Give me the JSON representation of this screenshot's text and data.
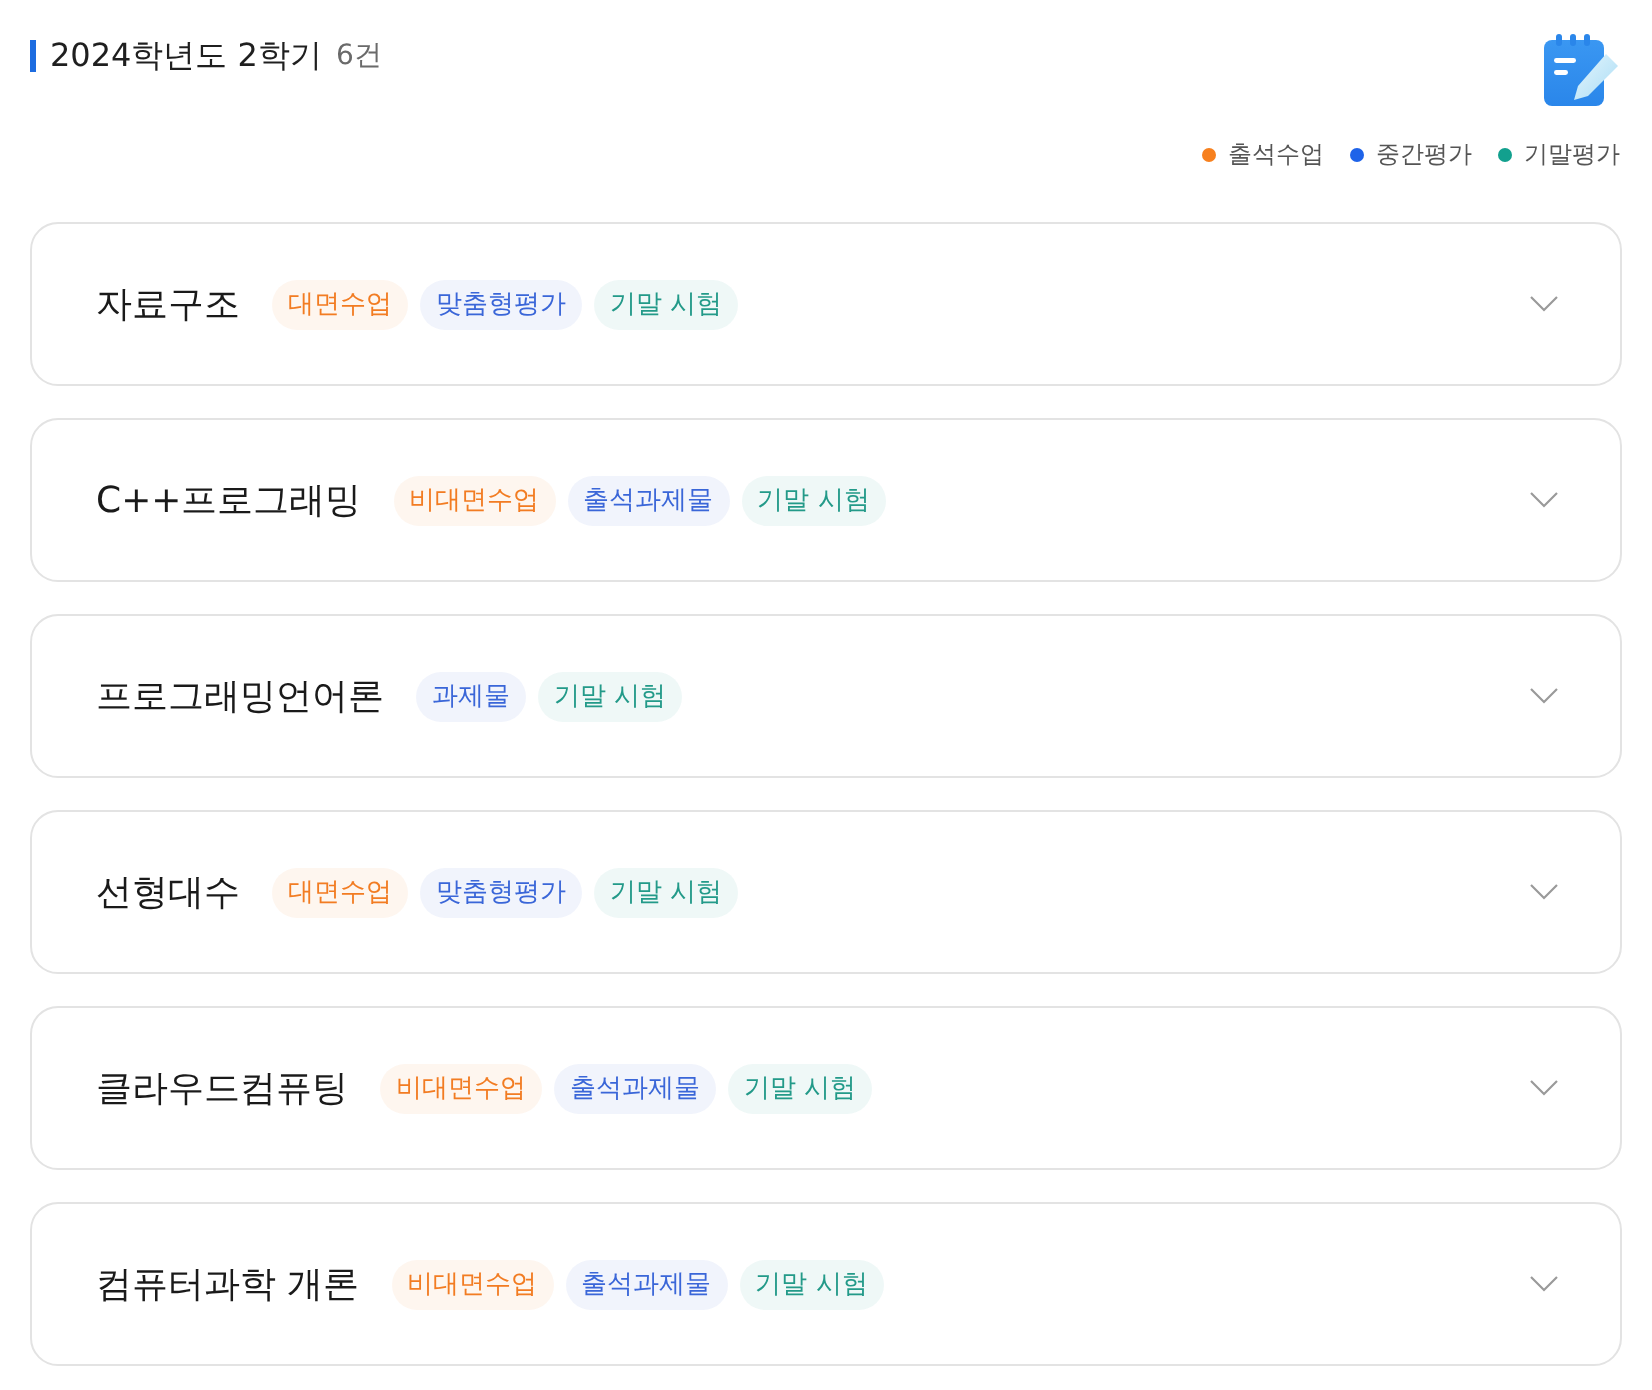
{
  "header": {
    "title": "2024학년도 2학기",
    "count": "6건"
  },
  "legend": [
    {
      "label": "출석수업",
      "color": "#f7801e"
    },
    {
      "label": "중간평가",
      "color": "#1e63e9"
    },
    {
      "label": "기말평가",
      "color": "#12a08e"
    }
  ],
  "courses": [
    {
      "name": "자료구조",
      "expanded": false,
      "tags": [
        {
          "label": "대면수업",
          "color": "#f27c22"
        },
        {
          "label": "맞춤형평가",
          "color": "#3a66d8"
        },
        {
          "label": "기말 시험",
          "color": "#239a89"
        }
      ]
    },
    {
      "name": "C++프로그래밍",
      "expanded": false,
      "tags": [
        {
          "label": "비대면수업",
          "color": "#f27c22"
        },
        {
          "label": "출석과제물",
          "color": "#3a66d8"
        },
        {
          "label": "기말 시험",
          "color": "#239a89"
        }
      ]
    },
    {
      "name": "프로그래밍언어론",
      "expanded": false,
      "tags": [
        {
          "label": "과제물",
          "color": "#3a66d8"
        },
        {
          "label": "기말 시험",
          "color": "#239a89"
        }
      ]
    },
    {
      "name": "선형대수",
      "expanded": false,
      "tags": [
        {
          "label": "대면수업",
          "color": "#f27c22"
        },
        {
          "label": "맞춤형평가",
          "color": "#3a66d8"
        },
        {
          "label": "기말 시험",
          "color": "#239a89"
        }
      ]
    },
    {
      "name": "클라우드컴퓨팅",
      "expanded": false,
      "tags": [
        {
          "label": "비대면수업",
          "color": "#f27c22"
        },
        {
          "label": "출석과제물",
          "color": "#3a66d8"
        },
        {
          "label": "기말 시험",
          "color": "#239a89"
        }
      ]
    },
    {
      "name": "컴퓨터과학 개론",
      "expanded": false,
      "tags": [
        {
          "label": "비대면수업",
          "color": "#f27c22"
        },
        {
          "label": "출석과제물",
          "color": "#3a66d8"
        },
        {
          "label": "기말 시험",
          "color": "#239a89"
        }
      ]
    }
  ]
}
